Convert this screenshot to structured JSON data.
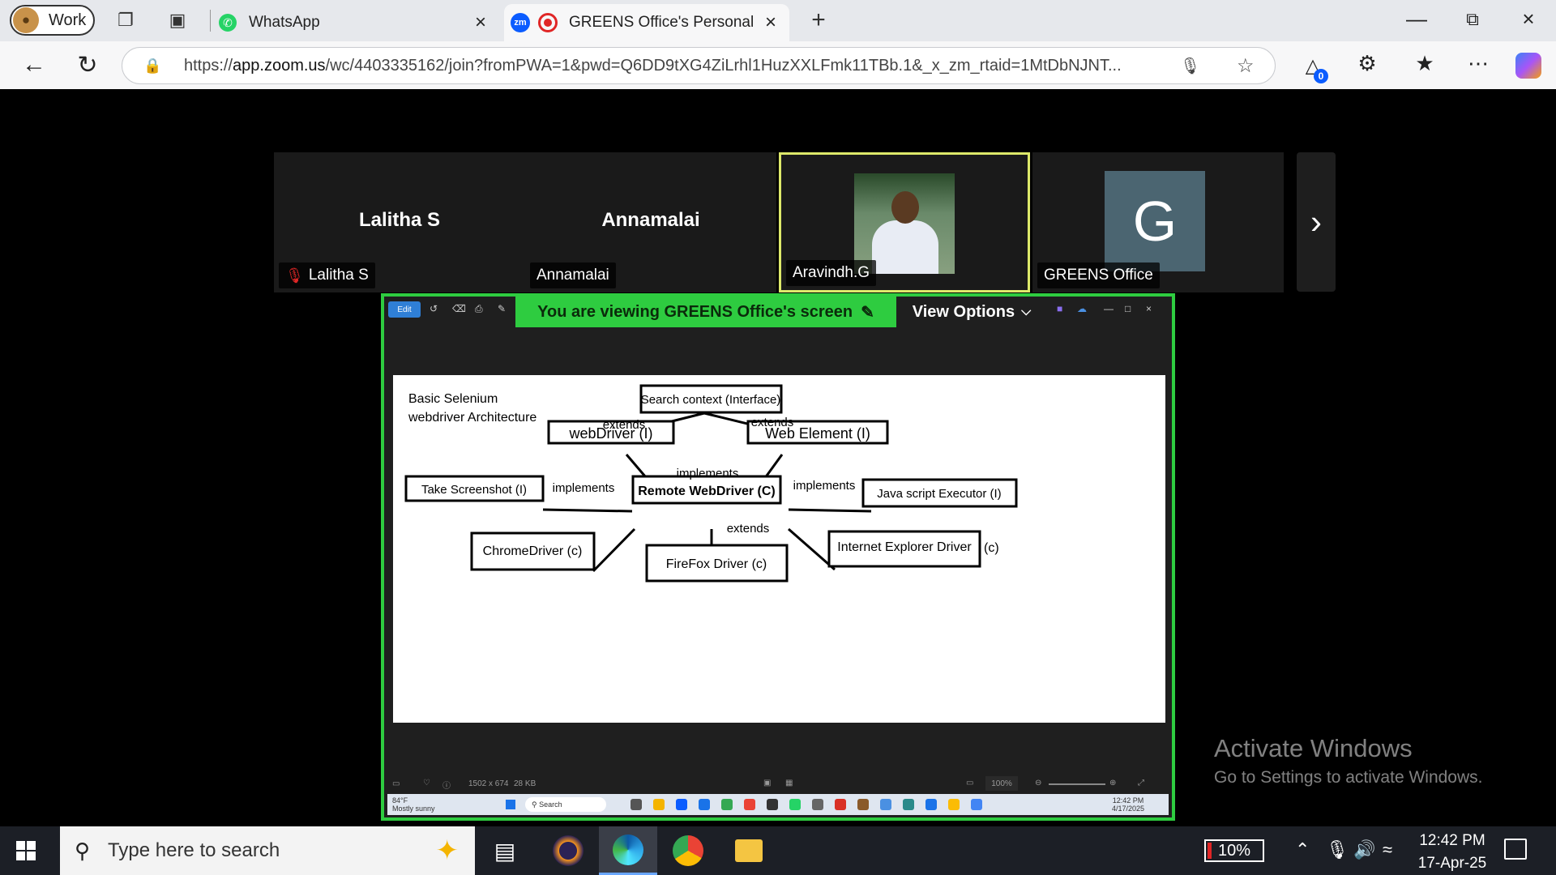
{
  "browser": {
    "profile_label": "Work",
    "tabs": [
      {
        "label": "WhatsApp"
      },
      {
        "label": "GREENS Office's Personal Meeting Room"
      }
    ],
    "url_prefix": "https://",
    "url_domain": "app.zoom.us",
    "url_rest": "/wc/4403335162/join?fromPWA=1&pwd=Q6DD9tXG4ZiLrhl1HuzXXLFmk11TBb.1&_x_zm_rtaid=1MtDbNJNT...",
    "extensions_badge": "0"
  },
  "meeting": {
    "participants": [
      {
        "display_name": "Lalitha S",
        "nameplate": "Lalitha S",
        "muted": true
      },
      {
        "display_name": "Annamalai",
        "nameplate": "Annamalai",
        "muted": false
      },
      {
        "display_name": "",
        "nameplate": "Aravindh.G",
        "speaking": true
      },
      {
        "display_name": "",
        "nameplate": "GREENS Office",
        "avatar_letter": "G"
      }
    ],
    "viewing_banner": "You are viewing  GREENS Office's screen",
    "view_options": "View Options",
    "share_toolbar_edit": "Edit"
  },
  "diagram": {
    "title_line1": "Basic Selenium",
    "title_line2": "webdriver Architecture",
    "nodes": {
      "search_context": "Search context  (Interface)",
      "webdriver": "webDriver (I)",
      "web_element": "Web Element (I)",
      "remote_webdriver": "Remote WebDriver (C)",
      "take_screenshot": "Take Screenshot (I)",
      "js_executor": "Java script Executor (I)",
      "chromedriver": "ChromeDriver (c)",
      "firefox_driver": "FireFox Driver (c)",
      "ie_driver": "Internet Explorer Driver",
      "ie_suffix": "(c)"
    },
    "edges": {
      "extends_left": "extends",
      "extends_right": "extends",
      "implements_top": "implements",
      "implements_left": "implements",
      "implements_right": "implements",
      "extends_bottom": "extends"
    }
  },
  "image_viewer": {
    "dimensions": "1502 x 674",
    "filesize": "28 KB",
    "zoom": "100%"
  },
  "remote_taskbar": {
    "weather_temp": "84°F",
    "weather_desc": "Mostly sunny",
    "search": "Search",
    "time": "12:42 PM",
    "date": "4/17/2025"
  },
  "watermark": {
    "line1": "Activate Windows",
    "line2": "Go to Settings to activate Windows."
  },
  "taskbar": {
    "search_placeholder": "Type here to search",
    "battery": "10%",
    "time": "12:42 PM",
    "date": "17-Apr-25"
  }
}
